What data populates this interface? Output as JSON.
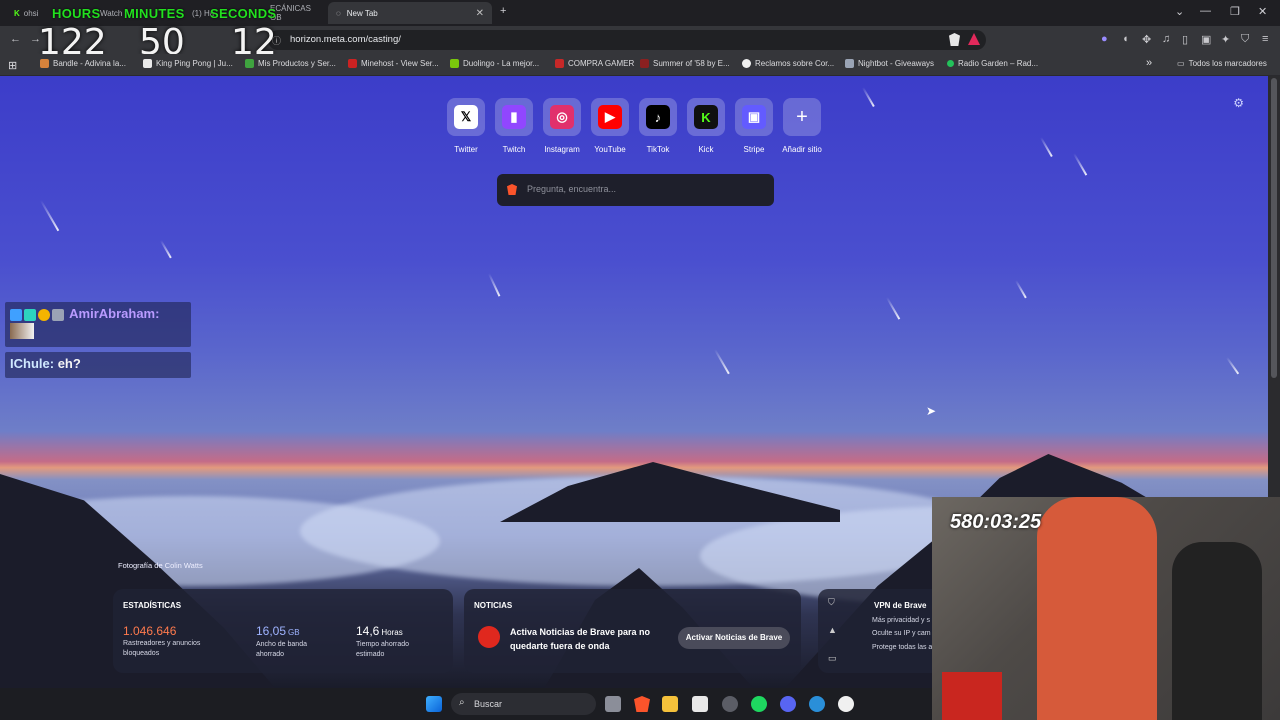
{
  "timer": {
    "labels": [
      "HOURS",
      "MINUTES",
      "SECONDS"
    ],
    "values": [
      "122",
      "50",
      "12"
    ]
  },
  "tabs": [
    {
      "label": "ohsi"
    },
    {
      "label": "Watch"
    },
    {
      "label": "(1) Ha"
    },
    {
      "label": "ECÁNICAS OB"
    },
    {
      "label": "New Tab"
    }
  ],
  "address": {
    "url": "horizon.meta.com/casting/"
  },
  "bookmarks": [
    {
      "label": "Bandle - Adivina la...",
      "color": "#d6823b"
    },
    {
      "label": "King Ping Pong | Ju...",
      "color": "#eaeaea"
    },
    {
      "label": "Mis Productos y Ser...",
      "color": "#3fa33f"
    },
    {
      "label": "Minehost - View Ser...",
      "color": "#cc2222"
    },
    {
      "label": "Duolingo - La mejor...",
      "color": "#7ac70c"
    },
    {
      "label": "COMPRA GAMER",
      "color": "#c62828"
    },
    {
      "label": "Summer of '58 by E...",
      "color": "#8a2020"
    },
    {
      "label": "Reclamos sobre Cor...",
      "color": "#f0f0f0"
    },
    {
      "label": "Nightbot - Giveaways",
      "color": "#9aa4b5"
    },
    {
      "label": "Radio Garden – Rad...",
      "color": "#23c15a"
    }
  ],
  "bookmarks_folder": "Todos los marcadores",
  "tiles": [
    {
      "label": "Twitter",
      "glyph": "𝕏",
      "bg": "#ffffff",
      "fg": "#000000"
    },
    {
      "label": "Twitch",
      "glyph": "▮",
      "bg": "#9146ff",
      "fg": "#ffffff"
    },
    {
      "label": "Instagram",
      "glyph": "◎",
      "bg": "#e1306c",
      "fg": "#ffffff"
    },
    {
      "label": "YouTube",
      "glyph": "▶",
      "bg": "#ff0000",
      "fg": "#ffffff"
    },
    {
      "label": "TikTok",
      "glyph": "♪",
      "bg": "#000000",
      "fg": "#ffffff"
    },
    {
      "label": "Kick",
      "glyph": "K",
      "bg": "#101010",
      "fg": "#53fc18"
    },
    {
      "label": "Stripe",
      "glyph": "▣",
      "bg": "#635bff",
      "fg": "#ffffff"
    },
    {
      "label": "Añadir sitio",
      "glyph": "+",
      "bg": "transparent",
      "fg": "#ffffff"
    }
  ],
  "search": {
    "placeholder": "Pregunta, encuentra..."
  },
  "chat": [
    {
      "user": "AmirAbraham:",
      "message": ""
    },
    {
      "user": "IChule:",
      "message": "eh?"
    }
  ],
  "photo_credit": "Fotografía de Colin Watts",
  "stats": {
    "title": "ESTADÍSTICAS",
    "blocked_value": "1.046.646",
    "blocked_desc": "Rastreadores y anuncios bloqueados",
    "bandwidth_value": "16,05",
    "bandwidth_unit": "GB",
    "bandwidth_desc": "Ancho de banda ahorrado",
    "time_value": "14,6",
    "time_unit": "Horas",
    "time_desc": "Tiempo ahorrado estimado"
  },
  "news": {
    "title": "NOTICIAS",
    "text": "Activa Noticias de Brave para no quedarte fuera de onda",
    "button": "Activar Noticias de Brave"
  },
  "vpn": {
    "title": "VPN de Brave",
    "items": [
      "Más privacidad y s",
      "Oculte su IP y cam",
      "Protege todas las a"
    ]
  },
  "taskbar": {
    "search": "Buscar"
  },
  "webcam": {
    "timer": "580:03:25"
  },
  "colors": {
    "accent": "#fb542b",
    "ntp_top": "#3c3dc9"
  }
}
